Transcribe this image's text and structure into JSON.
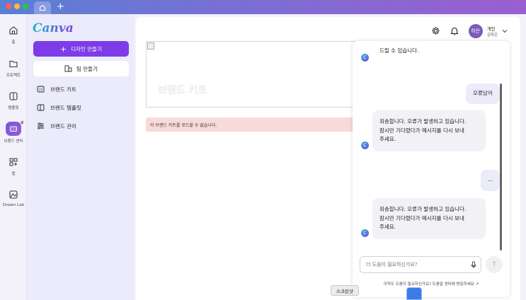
{
  "sidebar": {
    "items": [
      {
        "label": "홈",
        "icon": "home-icon"
      },
      {
        "label": "프로젝트",
        "icon": "folder-icon"
      },
      {
        "label": "템플릿",
        "icon": "template-icon"
      },
      {
        "label": "브랜드 센터",
        "icon": "brand-icon",
        "active": true
      },
      {
        "label": "앱",
        "icon": "apps-icon"
      },
      {
        "label": "Dream Lab",
        "icon": "dream-lab-icon"
      }
    ]
  },
  "panel": {
    "logo": "Canva",
    "create_design": "디자인 만들기",
    "create_team": "팀 만들기",
    "menu": [
      {
        "label": "브랜드 키트"
      },
      {
        "label": "브랜드 템플릿"
      },
      {
        "label": "브랜드 관리"
      }
    ]
  },
  "header": {
    "avatar_initials": "하은",
    "account_type": "개인",
    "account_name": "김하은"
  },
  "main": {
    "banner_title": "브랜드 키트",
    "error": "이 브랜드 키트를 로드할 수 없습니다."
  },
  "chat": {
    "top_fragment": "드릴 수 있습니다.",
    "user_msg_1": "오류났어",
    "bot_msg_1": [
      "죄송합니다. 오류가 발생하고 있습니다.",
      "잠시만 기다렸다가 메시지를 다시 보내",
      "주세요."
    ],
    "user_msg_2": "...",
    "bot_msg_2": [
      "죄송합니다. 오류가 발생하고 있습니다.",
      "잠시만 기다렸다가 메시지를 다시 보내",
      "주세요."
    ],
    "input_placeholder": "더 도움이 필요하신가요?",
    "help_text": "아직도 도움이 필요하신가요? 도움말 센터에 방문하세요"
  },
  "tooltip": "스크린샷",
  "colors": {
    "accent": "#7d3ce8",
    "error_bg": "#f8dada"
  }
}
